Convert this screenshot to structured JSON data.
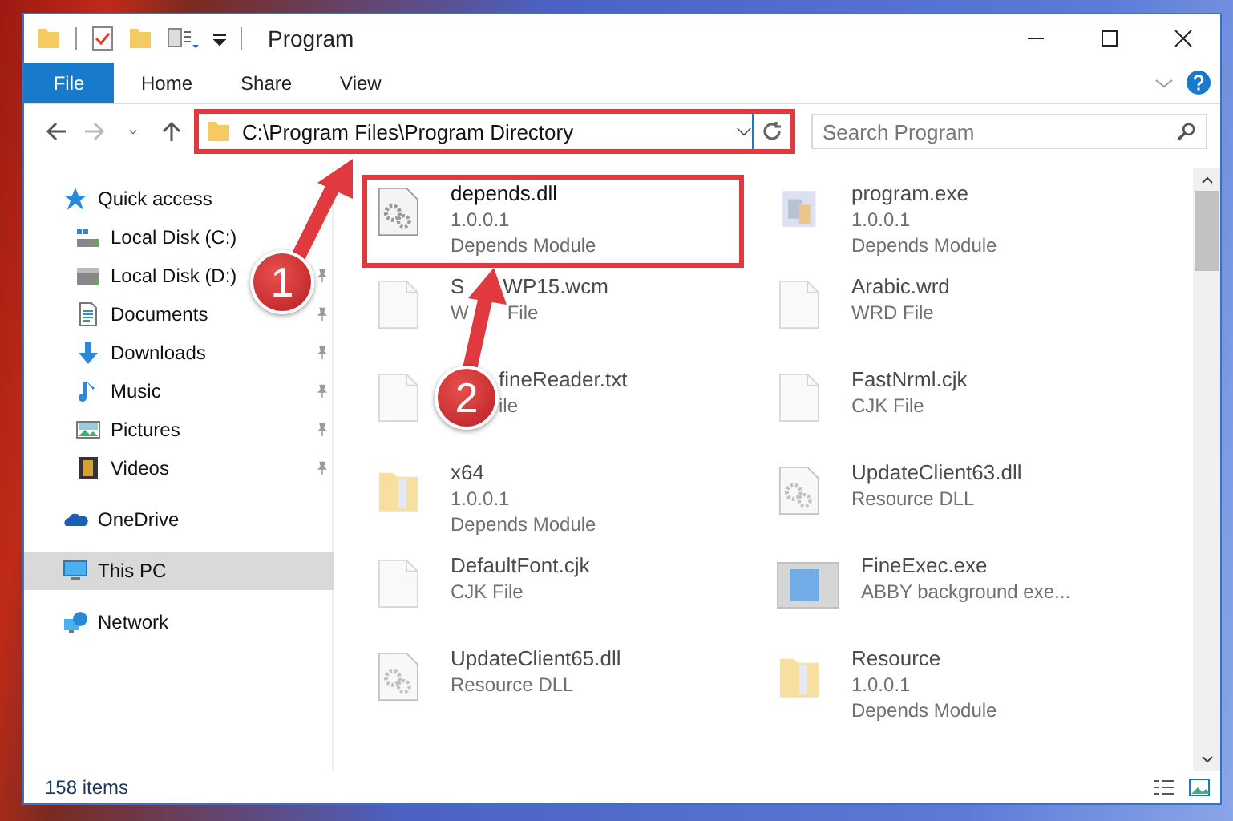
{
  "window": {
    "title": "Program"
  },
  "ribbon": {
    "file_tab": "File",
    "tabs": [
      "Home",
      "Share",
      "View"
    ]
  },
  "address": {
    "path": "C:\\Program Files\\Program Directory",
    "annotated": true
  },
  "search": {
    "placeholder": "Search Program"
  },
  "sidebar": {
    "items": [
      {
        "label": "Quick access",
        "selected": false,
        "children": [
          {
            "label": "Local Disk (C:)",
            "pinned": false,
            "selected": false
          },
          {
            "label": "Local Disk (D:)",
            "pinned": true,
            "selected": false
          },
          {
            "label": "Documents",
            "pinned": true,
            "selected": false
          },
          {
            "label": "Downloads",
            "pinned": true,
            "selected": false
          },
          {
            "label": "Music",
            "pinned": true,
            "selected": false
          },
          {
            "label": "Pictures",
            "pinned": true,
            "selected": false
          },
          {
            "label": "Videos",
            "pinned": true,
            "selected": false
          }
        ]
      },
      {
        "label": "OneDrive",
        "selected": false
      },
      {
        "label": "This PC",
        "selected": true
      },
      {
        "label": "Network",
        "selected": false
      }
    ]
  },
  "files": [
    {
      "kind": "library",
      "name": [
        "depends.dll"
      ],
      "lines": [
        [
          "1.0.0.1"
        ],
        [
          "Depends Module"
        ]
      ],
      "blurred": false,
      "annotated": true
    },
    {
      "kind": "program",
      "name": [
        "program.exe"
      ],
      "lines": [
        [
          "1.0.0.1"
        ],
        [
          "Depends Module"
        ]
      ],
      "blurred": true,
      "annotated": false
    },
    {
      "kind": "document",
      "name": [
        "S",
        "WP15.wcm"
      ],
      "lines": [
        [
          "W",
          "File"
        ]
      ],
      "blurred": true,
      "annotated": false
    },
    {
      "kind": "document",
      "name": [
        "Arabic.wrd"
      ],
      "lines": [
        [
          "WRD File"
        ]
      ],
      "blurred": true,
      "annotated": false
    },
    {
      "kind": "document",
      "name": [
        "fineReader.txt"
      ],
      "lines": [
        [
          "ile"
        ]
      ],
      "blurred": true,
      "annotated": false
    },
    {
      "kind": "document",
      "name": [
        "FastNrml.cjk"
      ],
      "lines": [
        [
          "CJK File"
        ]
      ],
      "blurred": true,
      "annotated": false
    },
    {
      "kind": "folder",
      "name": [
        "x64"
      ],
      "lines": [
        [
          "1.0.0.1"
        ],
        [
          "Depends Module"
        ]
      ],
      "blurred": true,
      "annotated": false
    },
    {
      "kind": "library",
      "name": [
        "UpdateClient63.dll"
      ],
      "lines": [
        [
          "Resource DLL"
        ]
      ],
      "blurred": true,
      "annotated": false
    },
    {
      "kind": "document",
      "name": [
        "DefaultFont.cjk"
      ],
      "lines": [
        [
          "CJK File"
        ]
      ],
      "blurred": true,
      "annotated": false
    },
    {
      "kind": "window",
      "name": [
        "FineExec.exe"
      ],
      "lines": [
        [
          "ABBY background exe..."
        ]
      ],
      "blurred": true,
      "annotated": false
    },
    {
      "kind": "library",
      "name": [
        "UpdateClient65.dll"
      ],
      "lines": [
        [
          "Resource DLL"
        ]
      ],
      "blurred": true,
      "annotated": false
    },
    {
      "kind": "folder",
      "name": [
        "Resource"
      ],
      "lines": [
        [
          "1.0.0.1"
        ],
        [
          "Depends Module"
        ]
      ],
      "blurred": true,
      "annotated": false
    }
  ],
  "status_bar": {
    "count": "158 items"
  },
  "annotations": {
    "callouts": [
      {
        "number": "1"
      },
      {
        "number": "2"
      }
    ]
  }
}
